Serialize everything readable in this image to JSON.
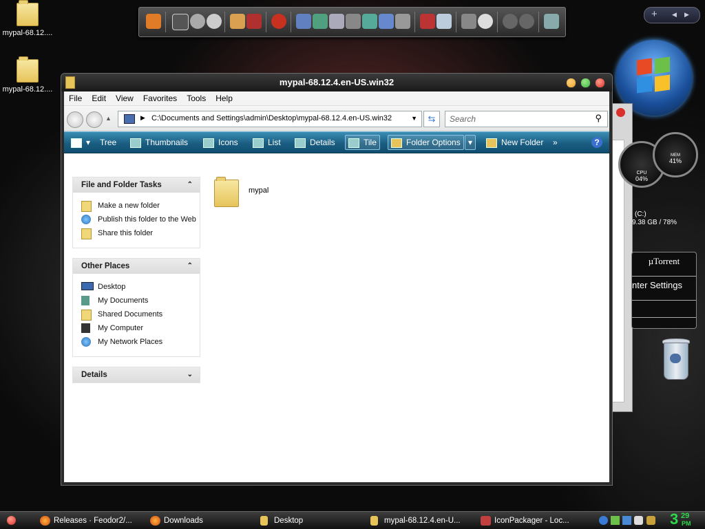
{
  "desktop": {
    "icons": [
      {
        "label": "mypal-68.12...."
      },
      {
        "label": "mypal-68.12...."
      }
    ]
  },
  "window": {
    "title": "mypal-68.12.4.en-US.win32",
    "menu": [
      "File",
      "Edit",
      "View",
      "Favorites",
      "Tools",
      "Help"
    ],
    "address": "C:\\Documents and Settings\\admin\\Desktop\\mypal-68.12.4.en-US.win32",
    "search_placeholder": "Search",
    "toolbar": {
      "tree": "Tree",
      "thumbnails": "Thumbnails",
      "icons": "Icons",
      "list": "List",
      "details": "Details",
      "tile": "Tile",
      "folder_options": "Folder Options",
      "new_folder": "New Folder",
      "more": "»",
      "help": "?"
    },
    "tasks_panel": {
      "title": "File and Folder Tasks",
      "items": [
        "Make a new folder",
        "Publish this folder to the Web",
        "Share this folder"
      ]
    },
    "places_panel": {
      "title": "Other Places",
      "items": [
        "Desktop",
        "My Documents",
        "Shared Documents",
        "My Computer",
        "My Network Places"
      ]
    },
    "details_panel": {
      "title": "Details"
    },
    "files": [
      {
        "name": "mypal"
      }
    ]
  },
  "widgets": {
    "gauge_cpu_label": "CPU",
    "gauge_cpu_value": "04%",
    "gauge_mem_label": "MEM",
    "gauge_mem_value": "41%",
    "drive_label": "(C:)",
    "drive_value": "9.38 GB / 78%",
    "utorrent_title": "µTorrent",
    "utorrent_item": "nter Settings"
  },
  "taskbar": {
    "tasks": [
      "Releases · Feodor2/...",
      "Downloads",
      "Desktop",
      "mypal-68.12.4.en-U...",
      "IconPackager - Loc..."
    ],
    "clock_hour": "3",
    "clock_min": "29",
    "clock_ampm": "PM"
  },
  "colors": {
    "toolbar_blue": "#1b5e82",
    "clock_green": "#2fd84a",
    "close_red": "#d9302b",
    "minimize_amber": "#e8a32a",
    "maximize_green": "#3cbd3c"
  }
}
